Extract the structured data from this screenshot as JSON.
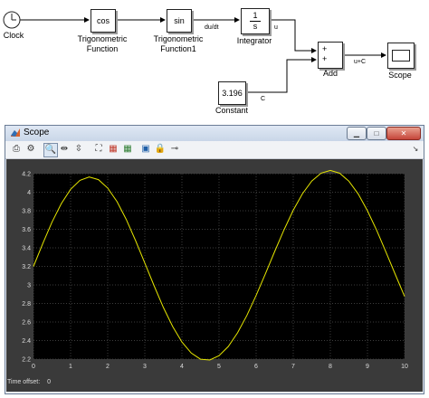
{
  "diagram": {
    "blocks": {
      "clock": {
        "label": "Clock"
      },
      "trig1": {
        "text": "cos",
        "label_line1": "Trigonometric",
        "label_line2": "Function"
      },
      "trig2": {
        "text": "sin",
        "label_line1": "Trigonometric",
        "label_line2": "Function1"
      },
      "integrator": {
        "numerator": "1",
        "denominator": "s",
        "label": "Integrator"
      },
      "add": {
        "port1": "+",
        "port2": "+",
        "label": "Add"
      },
      "scope": {
        "label": "Scope"
      },
      "constant": {
        "text": "3.196",
        "label": "Constant"
      }
    },
    "signals": {
      "dudt": "du/dt",
      "u": "u",
      "uc": "u+C",
      "c": "C"
    }
  },
  "scope_window": {
    "title": "Scope",
    "status_label": "Time offset:",
    "status_value": "0"
  },
  "chart_data": {
    "type": "line",
    "xlim": [
      0,
      10
    ],
    "ylim": [
      2.2,
      4.2
    ],
    "xticks": [
      "0",
      "1",
      "2",
      "3",
      "4",
      "5",
      "6",
      "7",
      "8",
      "9",
      "10"
    ],
    "yticks": [
      "2.2",
      "2.4",
      "2.6",
      "2.8",
      "3",
      "3.2",
      "3.4",
      "3.6",
      "3.8",
      "4",
      "4.2"
    ],
    "grid": true,
    "background": "#000000",
    "line_color": "#e6e600",
    "series": [
      {
        "x": [
          0,
          0.25,
          0.5,
          0.75,
          1,
          1.25,
          1.5,
          1.75,
          2,
          2.25,
          2.5,
          2.75,
          3,
          3.25,
          3.5,
          3.75,
          4,
          4.25,
          4.5,
          4.75,
          5,
          5.25,
          5.5,
          5.75,
          6,
          6.25,
          6.5,
          6.75,
          7,
          7.25,
          7.5,
          7.75,
          8,
          8.25,
          8.5,
          8.75,
          9,
          9.25,
          9.5,
          9.75,
          10
        ],
        "values": [
          3.2,
          3.447,
          3.679,
          3.878,
          4.031,
          4.128,
          4.164,
          4.136,
          4.045,
          3.899,
          3.706,
          3.478,
          3.236,
          2.99,
          2.757,
          2.551,
          2.384,
          2.265,
          2.199,
          2.19,
          2.237,
          2.337,
          2.484,
          2.671,
          2.887,
          3.121,
          3.361,
          3.594,
          3.806,
          3.985,
          4.121,
          4.206,
          4.235,
          4.205,
          4.119,
          3.981,
          3.8,
          3.587,
          3.353,
          3.112,
          2.876
        ]
      }
    ]
  }
}
